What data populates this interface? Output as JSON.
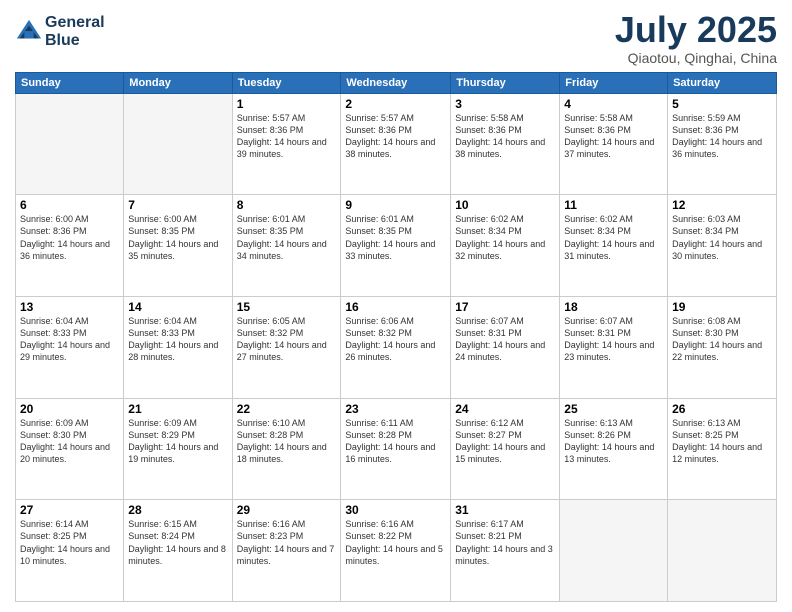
{
  "logo": {
    "line1": "General",
    "line2": "Blue"
  },
  "title": "July 2025",
  "subtitle": "Qiaotou, Qinghai, China",
  "weekdays": [
    "Sunday",
    "Monday",
    "Tuesday",
    "Wednesday",
    "Thursday",
    "Friday",
    "Saturday"
  ],
  "weeks": [
    [
      {
        "day": "",
        "detail": ""
      },
      {
        "day": "",
        "detail": ""
      },
      {
        "day": "1",
        "detail": "Sunrise: 5:57 AM\nSunset: 8:36 PM\nDaylight: 14 hours and 39 minutes."
      },
      {
        "day": "2",
        "detail": "Sunrise: 5:57 AM\nSunset: 8:36 PM\nDaylight: 14 hours and 38 minutes."
      },
      {
        "day": "3",
        "detail": "Sunrise: 5:58 AM\nSunset: 8:36 PM\nDaylight: 14 hours and 38 minutes."
      },
      {
        "day": "4",
        "detail": "Sunrise: 5:58 AM\nSunset: 8:36 PM\nDaylight: 14 hours and 37 minutes."
      },
      {
        "day": "5",
        "detail": "Sunrise: 5:59 AM\nSunset: 8:36 PM\nDaylight: 14 hours and 36 minutes."
      }
    ],
    [
      {
        "day": "6",
        "detail": "Sunrise: 6:00 AM\nSunset: 8:36 PM\nDaylight: 14 hours and 36 minutes."
      },
      {
        "day": "7",
        "detail": "Sunrise: 6:00 AM\nSunset: 8:35 PM\nDaylight: 14 hours and 35 minutes."
      },
      {
        "day": "8",
        "detail": "Sunrise: 6:01 AM\nSunset: 8:35 PM\nDaylight: 14 hours and 34 minutes."
      },
      {
        "day": "9",
        "detail": "Sunrise: 6:01 AM\nSunset: 8:35 PM\nDaylight: 14 hours and 33 minutes."
      },
      {
        "day": "10",
        "detail": "Sunrise: 6:02 AM\nSunset: 8:34 PM\nDaylight: 14 hours and 32 minutes."
      },
      {
        "day": "11",
        "detail": "Sunrise: 6:02 AM\nSunset: 8:34 PM\nDaylight: 14 hours and 31 minutes."
      },
      {
        "day": "12",
        "detail": "Sunrise: 6:03 AM\nSunset: 8:34 PM\nDaylight: 14 hours and 30 minutes."
      }
    ],
    [
      {
        "day": "13",
        "detail": "Sunrise: 6:04 AM\nSunset: 8:33 PM\nDaylight: 14 hours and 29 minutes."
      },
      {
        "day": "14",
        "detail": "Sunrise: 6:04 AM\nSunset: 8:33 PM\nDaylight: 14 hours and 28 minutes."
      },
      {
        "day": "15",
        "detail": "Sunrise: 6:05 AM\nSunset: 8:32 PM\nDaylight: 14 hours and 27 minutes."
      },
      {
        "day": "16",
        "detail": "Sunrise: 6:06 AM\nSunset: 8:32 PM\nDaylight: 14 hours and 26 minutes."
      },
      {
        "day": "17",
        "detail": "Sunrise: 6:07 AM\nSunset: 8:31 PM\nDaylight: 14 hours and 24 minutes."
      },
      {
        "day": "18",
        "detail": "Sunrise: 6:07 AM\nSunset: 8:31 PM\nDaylight: 14 hours and 23 minutes."
      },
      {
        "day": "19",
        "detail": "Sunrise: 6:08 AM\nSunset: 8:30 PM\nDaylight: 14 hours and 22 minutes."
      }
    ],
    [
      {
        "day": "20",
        "detail": "Sunrise: 6:09 AM\nSunset: 8:30 PM\nDaylight: 14 hours and 20 minutes."
      },
      {
        "day": "21",
        "detail": "Sunrise: 6:09 AM\nSunset: 8:29 PM\nDaylight: 14 hours and 19 minutes."
      },
      {
        "day": "22",
        "detail": "Sunrise: 6:10 AM\nSunset: 8:28 PM\nDaylight: 14 hours and 18 minutes."
      },
      {
        "day": "23",
        "detail": "Sunrise: 6:11 AM\nSunset: 8:28 PM\nDaylight: 14 hours and 16 minutes."
      },
      {
        "day": "24",
        "detail": "Sunrise: 6:12 AM\nSunset: 8:27 PM\nDaylight: 14 hours and 15 minutes."
      },
      {
        "day": "25",
        "detail": "Sunrise: 6:13 AM\nSunset: 8:26 PM\nDaylight: 14 hours and 13 minutes."
      },
      {
        "day": "26",
        "detail": "Sunrise: 6:13 AM\nSunset: 8:25 PM\nDaylight: 14 hours and 12 minutes."
      }
    ],
    [
      {
        "day": "27",
        "detail": "Sunrise: 6:14 AM\nSunset: 8:25 PM\nDaylight: 14 hours and 10 minutes."
      },
      {
        "day": "28",
        "detail": "Sunrise: 6:15 AM\nSunset: 8:24 PM\nDaylight: 14 hours and 8 minutes."
      },
      {
        "day": "29",
        "detail": "Sunrise: 6:16 AM\nSunset: 8:23 PM\nDaylight: 14 hours and 7 minutes."
      },
      {
        "day": "30",
        "detail": "Sunrise: 6:16 AM\nSunset: 8:22 PM\nDaylight: 14 hours and 5 minutes."
      },
      {
        "day": "31",
        "detail": "Sunrise: 6:17 AM\nSunset: 8:21 PM\nDaylight: 14 hours and 3 minutes."
      },
      {
        "day": "",
        "detail": ""
      },
      {
        "day": "",
        "detail": ""
      }
    ]
  ]
}
